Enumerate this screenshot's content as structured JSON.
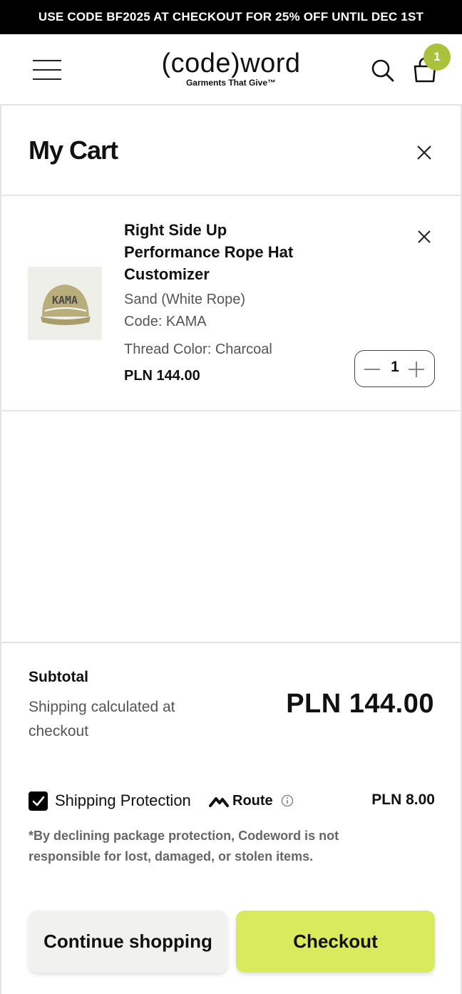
{
  "promo": {
    "text": "USE CODE BF2025 AT CHECKOUT FOR 25% OFF UNTIL DEC 1ST"
  },
  "header": {
    "logo": {
      "main": "(code)word",
      "tagline": "Garments That Give™"
    },
    "cart_count": "1",
    "icons": [
      "hamburger-menu-icon",
      "search-icon",
      "shopping-bag-icon"
    ]
  },
  "cart": {
    "title": "My Cart",
    "items": [
      {
        "name": "Right Side Up Performance Rope Hat Customizer",
        "variant": "Sand (White Rope)",
        "code": "Code: KAMA",
        "thread": "Thread Color: Charcoal",
        "price": "PLN 144.00",
        "quantity": "1",
        "image_text": "KAMA"
      }
    ]
  },
  "summary": {
    "subtotal_label": "Subtotal",
    "shipping_note": "Shipping calculated at checkout",
    "subtotal_value": "PLN 144.00",
    "protection_label": "Shipping Protection",
    "route_label": "Route",
    "protection_price": "PLN 8.00",
    "protection_checked": true,
    "disclaimer": "*By declining package protection, Codeword is not responsible for lost, damaged, or stolen items."
  },
  "buttons": {
    "continue": "Continue shopping",
    "checkout": "Checkout"
  },
  "colors": {
    "promo_bg": "#000000",
    "badge": "#a9c23c",
    "checkout_bg": "#d9ea5c",
    "continue_bg": "#f1f1ef",
    "hat": "#b9ad7c"
  }
}
